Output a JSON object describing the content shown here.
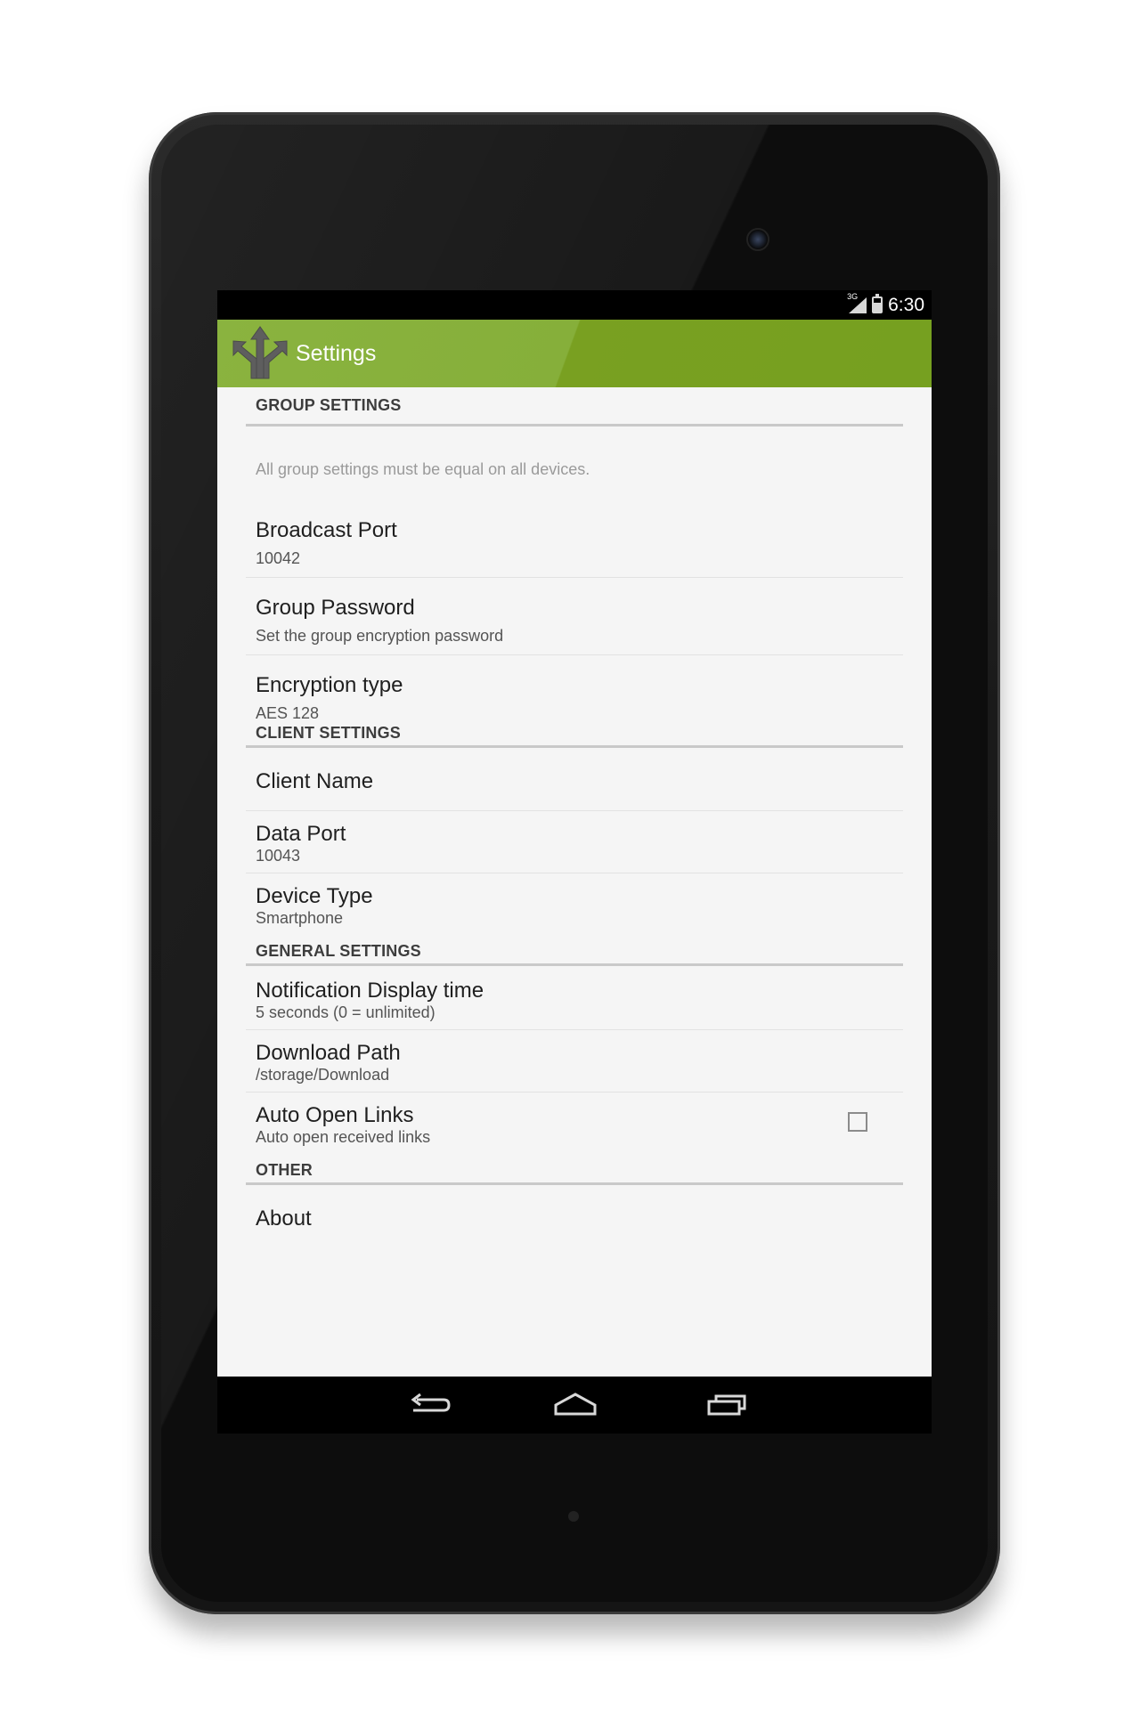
{
  "status_bar": {
    "network_label": "3G",
    "time": "6:30"
  },
  "action_bar": {
    "title": "Settings",
    "color": "#7aa224"
  },
  "sections": {
    "group": {
      "header": "GROUP SETTINGS",
      "note": "All group settings must be equal on all devices.",
      "broadcast_port": {
        "title": "Broadcast Port",
        "summary": "10042"
      },
      "group_password": {
        "title": "Group Password",
        "summary": "Set the group encryption password"
      },
      "encryption_type": {
        "title": "Encryption type",
        "summary": "AES 128"
      }
    },
    "client": {
      "header": "CLIENT SETTINGS",
      "client_name": {
        "title": "Client Name"
      },
      "data_port": {
        "title": "Data Port",
        "summary": "10043"
      },
      "device_type": {
        "title": "Device Type",
        "summary": "Smartphone"
      }
    },
    "general": {
      "header": "GENERAL SETTINGS",
      "notification_time": {
        "title": "Notification Display time",
        "summary": "5 seconds (0 = unlimited)"
      },
      "download_path": {
        "title": "Download Path",
        "summary": "/storage/Download"
      },
      "auto_open_links": {
        "title": "Auto Open Links",
        "summary": "Auto open received links",
        "checked": false
      }
    },
    "other": {
      "header": "OTHER",
      "about": {
        "title": "About"
      }
    }
  },
  "icons": {
    "app": "split-arrows-icon",
    "back": "back-icon",
    "home": "home-icon",
    "recent": "recent-apps-icon"
  }
}
